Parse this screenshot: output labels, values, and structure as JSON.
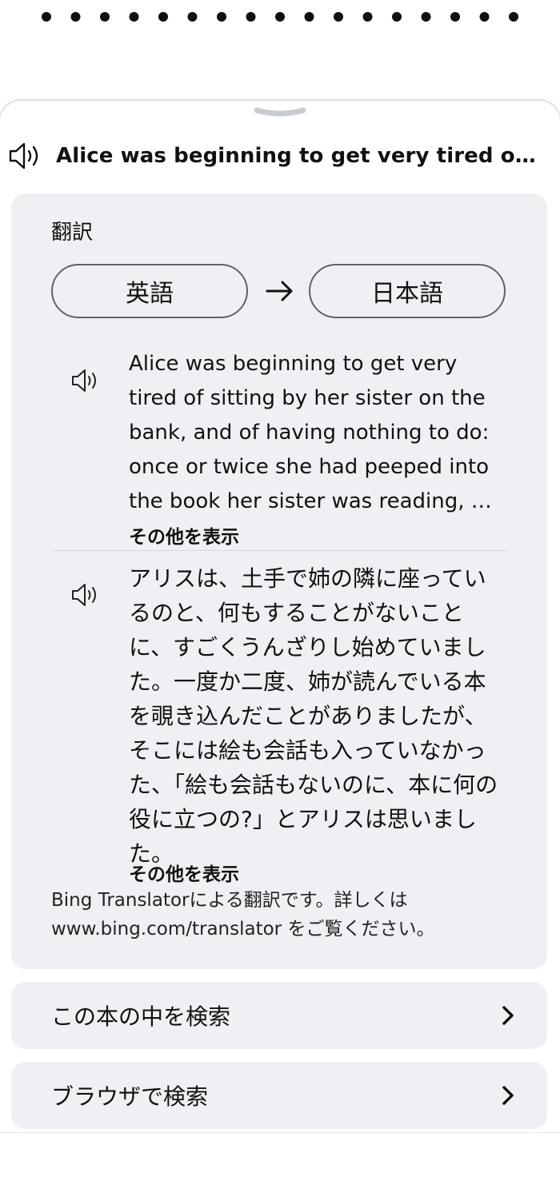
{
  "header": {
    "heading": "Alice was beginning to get very tired of s...",
    "heading_icon": "speaker-icon"
  },
  "translation": {
    "section_title": "翻訳",
    "source_language": "英語",
    "target_language": "日本語",
    "arrow_icon": "arrow-right-icon",
    "source_text": "Alice was beginning to get very tired of sitting by her sister on the bank, and of having nothing to do: once or twice she had peeped into the book her sister was reading, …",
    "source_more": "その他を表示",
    "target_text": "アリスは、土手で姉の隣に座っているのと、何もすることがないことに、すごくうんざりし始めていました。一度か二度、姉が読んでいる本を覗き込んだことがありましたが、そこには絵も会話も入っていなかった、「絵も会話もないのに、本に何の役に立つの?」とアリスは思いました。",
    "target_more": "その他を表示",
    "credit": "Bing Translatorによる翻訳です。詳しくは www.bing.com/translator をご覧ください。"
  },
  "actions": {
    "search_in_book": "この本の中を検索",
    "search_in_browser": "ブラウザで検索",
    "chevron_icon": "chevron-right-icon"
  },
  "colors": {
    "card_background": "#eef0f3",
    "pill_border": "#5f6368",
    "text": "#111111"
  }
}
